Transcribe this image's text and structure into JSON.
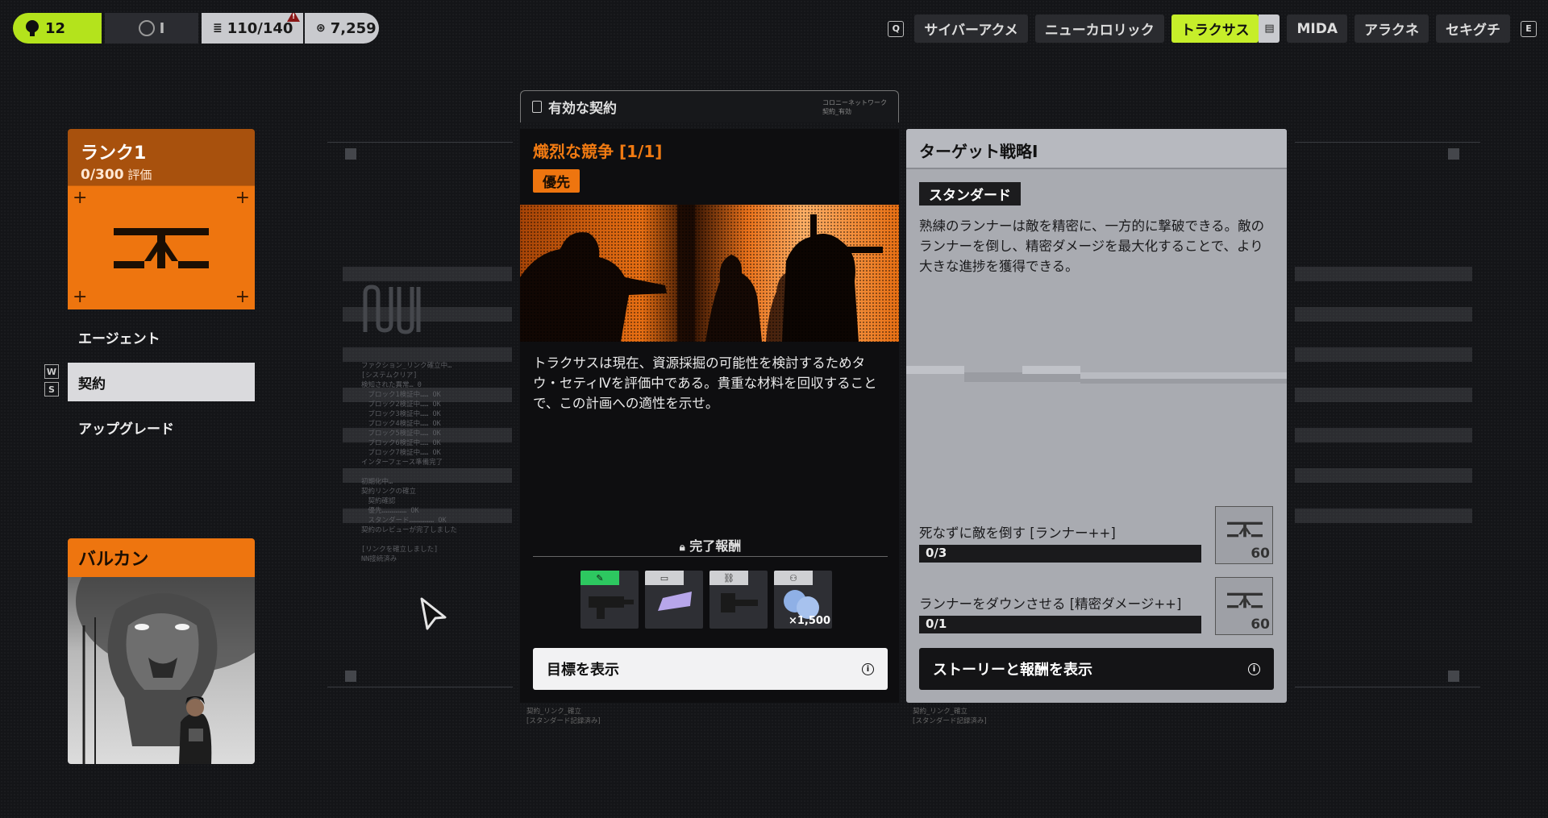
{
  "statusbar": {
    "level": "12",
    "loadout": "I",
    "inventory": "110/140",
    "currency": "7,259"
  },
  "factions": {
    "key_left": "Q",
    "key_right": "E",
    "tabs": [
      {
        "label": "サイバーアクメ",
        "active": false
      },
      {
        "label": "ニューカロリック",
        "active": false
      },
      {
        "label": "トラクサス",
        "active": true
      },
      {
        "label": "MIDA",
        "active": false
      },
      {
        "label": "アラクネ",
        "active": false
      },
      {
        "label": "セキグチ",
        "active": false
      }
    ]
  },
  "rank": {
    "title": "ランク1",
    "progress": "0/300",
    "progress_label": "評価"
  },
  "nav": {
    "key_up": "W",
    "key_down": "S",
    "items": [
      {
        "label": "エージェント",
        "selected": false
      },
      {
        "label": "契約",
        "selected": true
      },
      {
        "label": "アップグレード",
        "selected": false
      }
    ]
  },
  "agent": {
    "name": "バルカン"
  },
  "decor_log": [
    "ファクション_リンク確立中…",
    "[システムクリア]",
    "検知された異常… 0",
    "　ブロック1検証中…… OK",
    "　ブロック2検証中…… OK",
    "　ブロック3検証中…… OK",
    "　ブロック4検証中…… OK",
    "　ブロック5検証中…… OK",
    "　ブロック6検証中…… OK",
    "　ブロック7検証中…… OK",
    "インターフェース準備完了",
    "",
    "初期化中…",
    "契約リンクの確立",
    "　契約確認",
    "　優先……………… OK",
    "　スタンダード……………… OK",
    "契約のレビューが完了しました",
    "",
    "[リンクを確立しました]",
    "NN接続済み"
  ],
  "active_contract_tab": {
    "label": "有効な契約",
    "meta_line1": "コロニーネットワーク",
    "meta_line2": "契約_有効"
  },
  "contract": {
    "title": "熾烈な競争 [1/1]",
    "priority_badge": "優先",
    "description": "トラクサスは現在、資源採掘の可能性を検討するためタウ・セティⅣを評価中である。貴重な材料を回収することで、この計画への適性を示せ。",
    "reward_label": "完了報酬",
    "rewards": [
      {
        "name": "weapon-icon",
        "qty": ""
      },
      {
        "name": "chip-icon",
        "qty": ""
      },
      {
        "name": "attachment-icon",
        "qty": ""
      },
      {
        "name": "credit-icon",
        "qty": "×1,500"
      }
    ],
    "button_label": "目標を表示",
    "footnote1": "契約_リンク_確立",
    "footnote2": "[スタンダード記録済み]"
  },
  "strategy": {
    "title": "ターゲット戦略I",
    "badge": "スタンダード",
    "description": "熟練のランナーは敵を精密に、一方的に撃破できる。敵のランナーを倒し、精密ダメージを最大化することで、より大きな進捗を獲得できる。",
    "objectives": [
      {
        "label": "死なずに敵を倒す [ランナー++]",
        "progress": "0/3",
        "points": "60"
      },
      {
        "label": "ランナーをダウンさせる [精密ダメージ++]",
        "progress": "0/1",
        "points": "60"
      }
    ],
    "button_label": "ストーリーと報酬を表示",
    "footnote1": "契約_リンク_確立",
    "footnote2": "[スタンダード記録済み]"
  },
  "colors": {
    "accent_green": "#c6ee2a",
    "accent_orange": "#ee750f",
    "panel_grey": "#a9abb1",
    "background": "#141518"
  }
}
